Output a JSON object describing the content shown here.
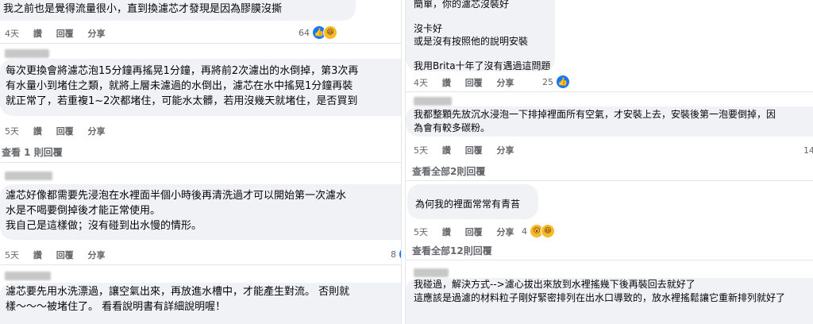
{
  "left": {
    "c1": {
      "lines": [
        "我之前也是覺得流量很小，直到換濾芯才發現是因為膠膜沒撕"
      ],
      "age": "4天",
      "like": "讚",
      "reply": "回覆",
      "share": "分享",
      "reactions": "64"
    },
    "c2": {
      "lines": [
        "每次更換會將濾芯泡15分鐘再搖晃1分鐘，再將前2次濾出的水倒掉，第3次再",
        "有水量小到堵住之類，就將上層未濾過的水倒出，濾芯在水中搖晃1分鐘再裝",
        "就正常了，若重複1~2次都堵住，可能水太髒，若用沒幾天就堵住，是否買到"
      ],
      "age": "5天",
      "like": "讚",
      "reply": "回覆",
      "share": "分享",
      "view_replies": "查看 1 則回覆"
    },
    "c3": {
      "lines": [
        "濾芯好像都需要先浸泡在水裡面半個小時後再清洗過才可以開始第一次濾水",
        "水是不喝要倒掉後才能正常使用。",
        "我自己是這樣做；沒有碰到出水慢的情形。"
      ],
      "age": "5天",
      "like": "讚",
      "reply": "回覆",
      "share": "分享",
      "reactions": "8"
    },
    "c4": {
      "lines": [
        "濾芯要先用水洗漂過，讓空氣出來，再放進水槽中，才能產生對流。 否則就",
        "樣～～～被堵住了。 看看說明書有詳細說明喔！"
      ]
    }
  },
  "right": {
    "c1": {
      "lines": [
        "簡單，你的濾芯沒裝好",
        "",
        "沒卡好",
        "或是沒有按照他的說明安裝",
        "",
        "我用Brita十年了沒有遇過這問題"
      ],
      "age": "4天",
      "like": "讚",
      "reply": "回覆",
      "share": "分享",
      "reactions": "25"
    },
    "c2": {
      "lines": [
        "我都整顆先放沉水浸泡一下排掉裡面所有空氣，才安裝上去，安裝後第一泡要倒掉，因",
        "為會有較多碳粉。"
      ],
      "age": "5天",
      "like": "讚",
      "reply": "回覆",
      "share": "分享",
      "reactions": "14",
      "view_replies": "查看全部2則回覆"
    },
    "c3": {
      "lines": [
        "為何我的裡面常常有青苔"
      ],
      "age": "5天",
      "like": "讚",
      "reply": "回覆",
      "share": "分享",
      "reactions": "4",
      "view_replies": "查看全部12則回覆"
    },
    "c4": {
      "lines": [
        "我碰過，解決方式-->濾心拔出來放到水裡搖幾下後再裝回去就好了",
        "這應該是過濾的材料粒子剛好緊密排列在出水口導致的，放水裡搖鬆讓它重新排列就好了"
      ]
    }
  },
  "colors": {
    "bubble": "#f0f2f5",
    "meta": "#65676b",
    "like_blue": "#1877f2",
    "emoji_yellow": "#f7b928"
  },
  "icons": [
    "like-icon",
    "haha-icon",
    "wow-icon"
  ]
}
